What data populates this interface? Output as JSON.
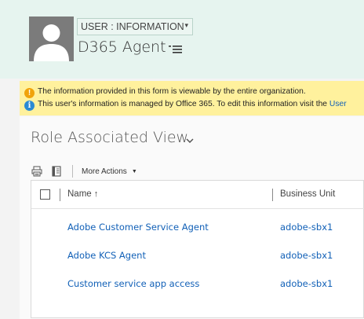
{
  "header": {
    "form_selector": {
      "label": "USER : INFORMATION",
      "caret": "▾",
      "caret_icon": "caret-down-icon"
    },
    "record_title": "D365 Agent",
    "title_menu_icon": "list-menu-icon",
    "avatar_icon": "person-silhouette-icon",
    "background_color": "#e6f4ef"
  },
  "notifications": [
    {
      "icon": "warning-icon",
      "icon_glyph": "!",
      "text": "The information provided in this form is viewable by the entire organization.",
      "link": ""
    },
    {
      "icon": "info-icon",
      "icon_glyph": "i",
      "text": "This user's information is managed by Office 365. To edit this information visit the ",
      "link": "User"
    }
  ],
  "view": {
    "title": "Role Associated View",
    "chevron_icon": "chevron-down-icon",
    "commands": {
      "print_icon": "print-icon",
      "report_icon": "report-book-icon",
      "more_actions": "More Actions",
      "more_caret": "▼"
    },
    "grid": {
      "columns": [
        {
          "label": "Name",
          "sort_glyph": "↑",
          "sort_icon": "sort-ascending-icon"
        },
        {
          "label": "Business Unit"
        }
      ],
      "rows": [
        {
          "name": "Adobe Customer Service Agent",
          "business_unit": "adobe-sbx1"
        },
        {
          "name": "Adobe KCS Agent",
          "business_unit": "adobe-sbx1"
        },
        {
          "name": "Customer service app access",
          "business_unit": "adobe-sbx1"
        }
      ]
    }
  },
  "colors": {
    "notification_bg": "#fff19d",
    "warning": "#f0a30a",
    "info": "#2c8ad3",
    "link": "#1160b7"
  }
}
